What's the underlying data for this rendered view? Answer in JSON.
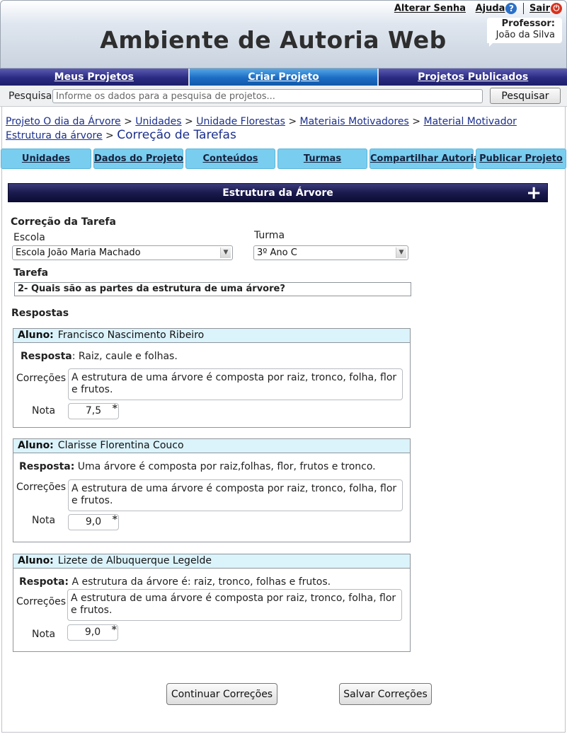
{
  "header": {
    "title": "Ambiente de Autoria Web",
    "change_password": "Alterar Senha",
    "help": "Ajuda",
    "logout": "Sair",
    "teacher_label": "Professor:",
    "teacher_name": "João da Silva"
  },
  "main_nav": {
    "items": [
      {
        "label": "Meus Projetos"
      },
      {
        "label": "Criar Projeto"
      },
      {
        "label": "Projetos Publicados"
      }
    ]
  },
  "search": {
    "label": "Pesquisa",
    "placeholder": "Informe os dados para a pesquisa de projetos...",
    "button": "Pesquisar"
  },
  "breadcrumb": {
    "items": [
      "Projeto O dia da Árvore",
      "Unidades",
      "Unidade Florestas",
      "Materiais Motivadores",
      "Material Motivador Estrutura da árvore"
    ],
    "separator": ">",
    "current": "Correção de Tarefas"
  },
  "sub_tabs": {
    "items": [
      {
        "label": "Unidades"
      },
      {
        "label": "Dados do Projeto"
      },
      {
        "label": "Conteúdos"
      },
      {
        "label": "Turmas"
      },
      {
        "label": "Compartilhar Autoria"
      },
      {
        "label": "Publicar Projeto"
      }
    ]
  },
  "section": {
    "title": "Estrutura da Árvore",
    "plus": "+"
  },
  "correction": {
    "title": "Correção da Tarefa",
    "school_label": "Escola",
    "school_value": "Escola João Maria Machado",
    "class_label": "Turma",
    "class_value": "3º Ano C",
    "task_label": "Tarefa",
    "task_value": "2- Quais são as partes  da estrutura de uma árvore?",
    "answers_label": "Respostas"
  },
  "answers": [
    {
      "student_label": "Aluno:",
      "student": "Francisco Nascimento Ribeiro",
      "answer_label": "Resposta",
      "answer": ": Raiz, caule e folhas.",
      "corrections_label": "Correções",
      "correction": "A estrutura de uma árvore é composta por raiz, tronco, folha, flor e frutos.",
      "grade_label": "Nota",
      "grade": "7,5"
    },
    {
      "student_label": "Aluno:",
      "student": "Clarisse  Florentina Couco",
      "answer_label": "Resposta:",
      "answer": "Uma árvore é composta por raiz,folhas, flor, frutos e tronco.",
      "corrections_label": "Correções",
      "correction": "A estrutura de uma árvore é composta por raiz, tronco, folha, flor e frutos.",
      "grade_label": "Nota",
      "grade": "9,0"
    },
    {
      "student_label": "Aluno:",
      "student": "Lizete de Albuquerque Legelde",
      "answer_label": "Respota:",
      "answer": "A estrutura da árvore é: raiz, tronco, folhas e frutos.",
      "corrections_label": "Correções",
      "correction": "A estrutura de uma árvore é composta por raiz, tronco, folha, flor e frutos.",
      "grade_label": "Nota",
      "grade": "9,0"
    }
  ],
  "buttons": {
    "continue": "Continuar Correções",
    "save": "Salvar Correções"
  },
  "required_mark": "*",
  "colors": {
    "nav_dark": "#28296f",
    "nav_active": "#1b6cc4",
    "tab_bg": "#79cdef",
    "card_header": "#dbf3fb",
    "link": "#1a2f8f"
  }
}
